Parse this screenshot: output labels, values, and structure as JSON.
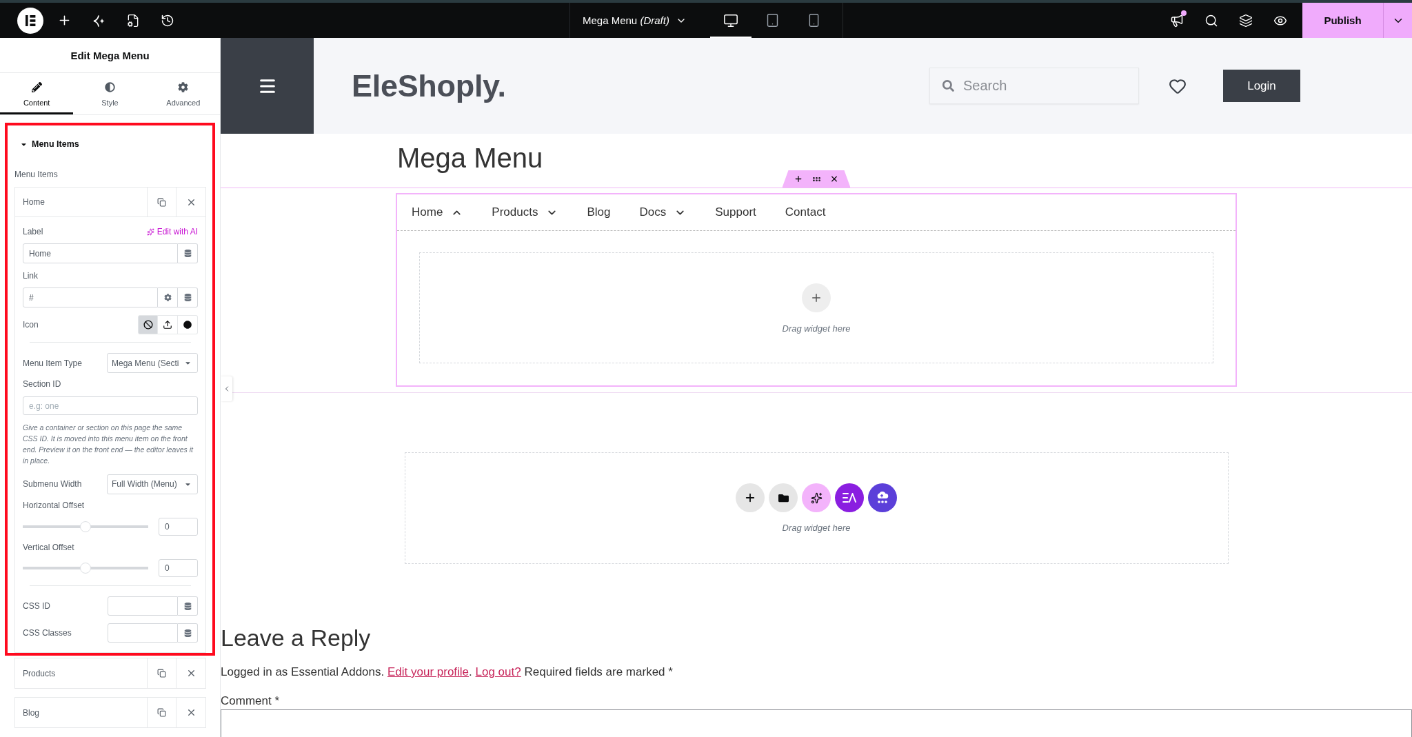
{
  "top_bar": {
    "document_title": "Mega Menu *(Draft)*",
    "devices": [
      {
        "kind": "desktop",
        "selected": true
      },
      {
        "kind": "tablet",
        "selected": false
      },
      {
        "kind": "mobile",
        "selected": false
      }
    ],
    "notifications_unread": true,
    "publish_label": "Publish"
  },
  "panel": {
    "title": "Edit Mega Menu",
    "tabs": [
      {
        "kind": "content",
        "label": "Content",
        "selected": true
      },
      {
        "kind": "style",
        "label": "Style",
        "selected": false
      },
      {
        "kind": "advanced",
        "label": "Advanced",
        "selected": false
      }
    ],
    "section": {
      "title": "Menu Items",
      "expanded": true,
      "highlighted": true,
      "repeater_label": "Menu Items",
      "items": [
        {
          "title": "Home",
          "expanded": true,
          "settings": {
            "label": {
              "label": "Label",
              "ai_action": "Edit with AI",
              "value": "Home"
            },
            "link": {
              "label": "Link",
              "value": "#"
            },
            "icon": {
              "label": "Icon",
              "options": [
                {
                  "kind": "none",
                  "selected": true
                },
                {
                  "kind": "upload",
                  "selected": false
                },
                {
                  "kind": "library",
                  "selected": false
                }
              ]
            },
            "item_type": {
              "label": "Menu Item Type",
              "value": "Mega Menu (Secti"
            },
            "section_id": {
              "label": "Section ID",
              "placeholder": "e.g: one",
              "help": "Give a container or section on this page the same CSS ID. It is moved into this menu item on the front end. Preview it on the front end — the editor leaves it in place."
            },
            "submenu_width": {
              "label": "Submenu Width",
              "value": "Full Width (Menu)"
            },
            "offsets": [
              {
                "label": "Horizontal Offset",
                "level": 0.5,
                "value": "0"
              },
              {
                "label": "Vertical Offset",
                "level": 0.5,
                "value": "0"
              }
            ],
            "css_id": {
              "label": "CSS ID"
            },
            "css_classes": {
              "label": "CSS Classes"
            }
          }
        },
        {
          "title": "Products",
          "expanded": false
        },
        {
          "title": "Blog",
          "expanded": false
        }
      ]
    }
  },
  "canvas": {
    "site_header": {
      "logo": "EleShoply.",
      "search_placeholder": "Search",
      "login_label": "Login"
    },
    "page_title": "Mega Menu",
    "mega_menu": {
      "items": [
        {
          "label": "Home",
          "submenu": {
            "expanded": true
          }
        },
        {
          "label": "Products",
          "submenu": {
            "expanded": false
          }
        },
        {
          "label": "Blog"
        },
        {
          "label": "Docs",
          "submenu": {
            "expanded": false
          }
        },
        {
          "label": "Support"
        },
        {
          "label": "Contact"
        }
      ],
      "drop_hint": "Drag widget here"
    },
    "empty_section": {
      "drop_hint": "Drag widget here"
    },
    "comments": {
      "title": "Leave a Reply",
      "notice": [
        {
          "kind": "text",
          "text": "Logged in as Essential Addons. "
        },
        {
          "kind": "link",
          "text": "Edit your profile"
        },
        {
          "kind": "text",
          "text": ". "
        },
        {
          "kind": "link",
          "text": "Log out?"
        },
        {
          "kind": "text",
          "text": " Required fields are marked *"
        }
      ],
      "comment_label": "Comment *"
    }
  }
}
